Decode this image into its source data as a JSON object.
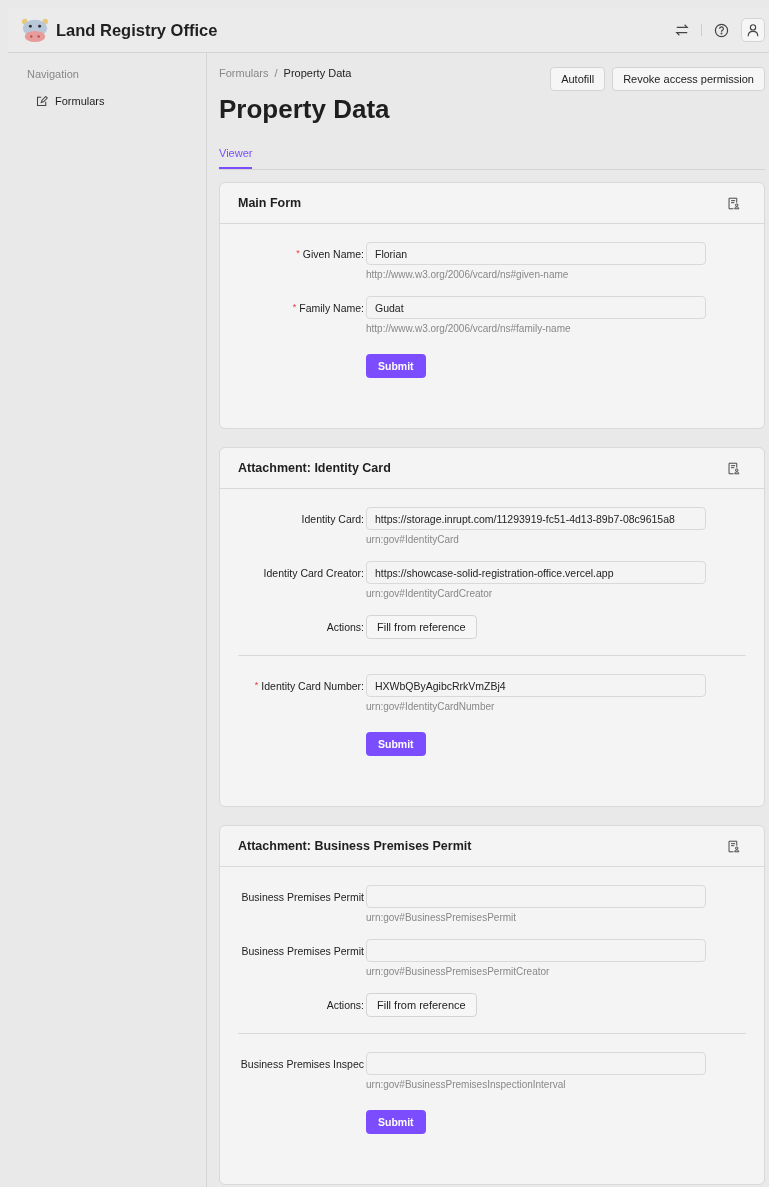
{
  "header": {
    "title": "Land Registry Office"
  },
  "sidebar": {
    "heading": "Navigation",
    "items": [
      {
        "label": "Formulars",
        "selected": false
      }
    ]
  },
  "breadcrumb": [
    {
      "label": "Formulars",
      "current": false
    },
    {
      "label": "Property Data",
      "current": true
    }
  ],
  "separator": "/",
  "actions": [
    "Autofill",
    "Revoke access permission"
  ],
  "page_title": "Property Data",
  "tabs": [
    {
      "label": "Viewer",
      "selected": true
    }
  ],
  "cards": [
    {
      "title": "Main Form",
      "groups": [
        {
          "rows": [
            {
              "kind": "field",
              "label": "Given Name:",
              "required_mark": "*",
              "value": "Florian",
              "hint": "http://www.w3.org/2006/vcard/ns#given-name"
            },
            {
              "kind": "field",
              "label": "Family Name:",
              "required_mark": "*",
              "value": "Gudat",
              "hint": "http://www.w3.org/2006/vcard/ns#family-name"
            }
          ]
        }
      ],
      "submit": "Submit"
    },
    {
      "title": "Attachment: Identity Card",
      "groups": [
        {
          "rows": [
            {
              "kind": "field",
              "label": "Identity Card:",
              "value": "https://storage.inrupt.com/11293919-fc51-4d13-89b7-08c9615a8",
              "hint": "urn:gov#IdentityCard"
            },
            {
              "kind": "field",
              "label": "Identity Card Creator:",
              "value": "https://showcase-solid-registration-office.vercel.app",
              "hint": "urn:gov#IdentityCardCreator"
            },
            {
              "kind": "actions",
              "label": "Actions:",
              "button": "Fill from reference"
            }
          ]
        },
        {
          "rows": [
            {
              "kind": "field",
              "label": "Identity Card Number:",
              "required_mark": "*",
              "value": "HXWbQByAgibcRrkVmZBj4",
              "hint": "urn:gov#IdentityCardNumber"
            }
          ]
        }
      ],
      "submit": "Submit"
    },
    {
      "title": "Attachment: Business Premises Permit",
      "groups": [
        {
          "rows": [
            {
              "kind": "field",
              "label": "Business Premises Permit",
              "hint": "urn:gov#BusinessPremisesPermit"
            },
            {
              "kind": "field",
              "label": "Business Premises Permit",
              "hint": "urn:gov#BusinessPremisesPermitCreator"
            },
            {
              "kind": "actions",
              "label": "Actions:",
              "button": "Fill from reference"
            }
          ]
        },
        {
          "rows": [
            {
              "kind": "field",
              "label": "Business Premises Inspec",
              "hint": "urn:gov#BusinessPremisesInspectionInterval"
            }
          ]
        }
      ],
      "submit": "Submit"
    }
  ]
}
